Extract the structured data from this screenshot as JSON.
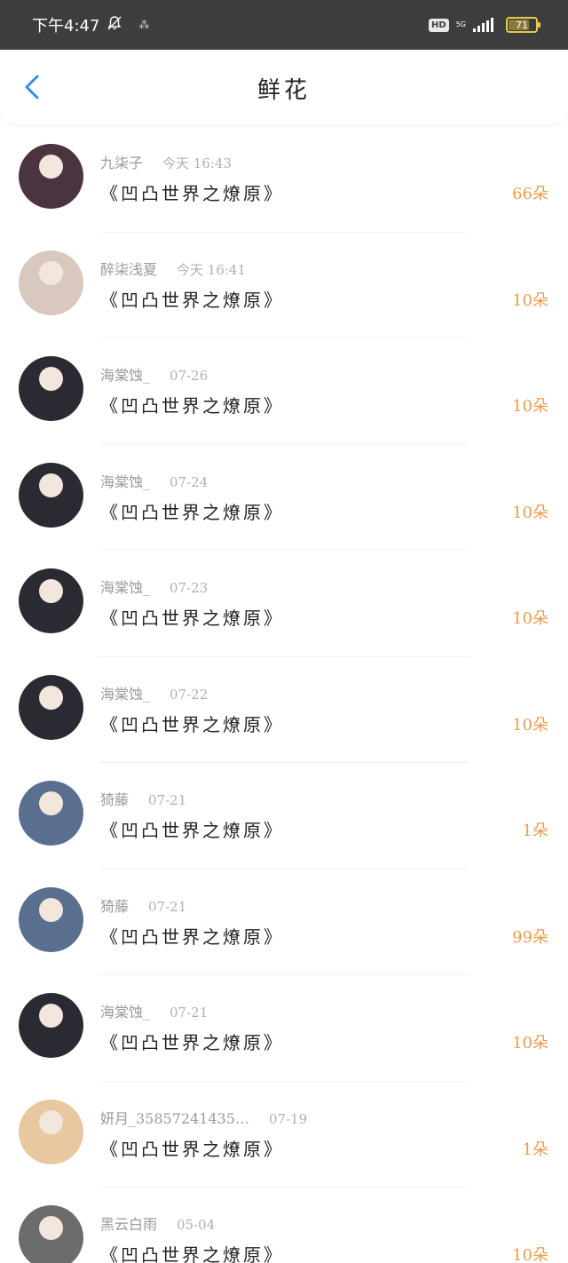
{
  "status_bar": {
    "time": "下午4:47",
    "hd": "HD",
    "network": "5G",
    "battery": "71",
    "battery_level": 0.71
  },
  "header": {
    "title": "鲜花",
    "back_icon": "chevron-left-icon",
    "accent_color": "#2f8fe8"
  },
  "items": [
    {
      "user": "九柒子",
      "time": "今天 16:43",
      "book": "《凹凸世界之燎原》",
      "count": "66朵",
      "avatar_color": "#4a3440"
    },
    {
      "user": "醉柒浅夏",
      "time": "今天 16:41",
      "book": "《凹凸世界之燎原》",
      "count": "10朵",
      "avatar_color": "#d9c8be"
    },
    {
      "user": "海棠蚀_",
      "time": "07-26",
      "book": "《凹凸世界之燎原》",
      "count": "10朵",
      "avatar_color": "#2a2a32"
    },
    {
      "user": "海棠蚀_",
      "time": "07-24",
      "book": "《凹凸世界之燎原》",
      "count": "10朵",
      "avatar_color": "#2a2a32"
    },
    {
      "user": "海棠蚀_",
      "time": "07-23",
      "book": "《凹凸世界之燎原》",
      "count": "10朵",
      "avatar_color": "#2a2a32"
    },
    {
      "user": "海棠蚀_",
      "time": "07-22",
      "book": "《凹凸世界之燎原》",
      "count": "10朵",
      "avatar_color": "#2a2a32"
    },
    {
      "user": "猗藤",
      "time": "07-21",
      "book": "《凹凸世界之燎原》",
      "count": "1朵",
      "avatar_color": "#5a6f8f"
    },
    {
      "user": "猗藤",
      "time": "07-21",
      "book": "《凹凸世界之燎原》",
      "count": "99朵",
      "avatar_color": "#5a6f8f"
    },
    {
      "user": "海棠蚀_",
      "time": "07-21",
      "book": "《凹凸世界之燎原》",
      "count": "10朵",
      "avatar_color": "#2a2a32"
    },
    {
      "user": "妍月_35857241435…",
      "time": "07-19",
      "book": "《凹凸世界之燎原》",
      "count": "1朵",
      "avatar_color": "#e8c8a0"
    },
    {
      "user": "黑云白雨",
      "time": "05-04",
      "book": "《凹凸世界之燎原》",
      "count": "10朵",
      "avatar_color": "#6c6c6c"
    }
  ],
  "colors": {
    "count": "#ef9b4c",
    "title": "#222222",
    "meta": "#9a9a9a"
  }
}
